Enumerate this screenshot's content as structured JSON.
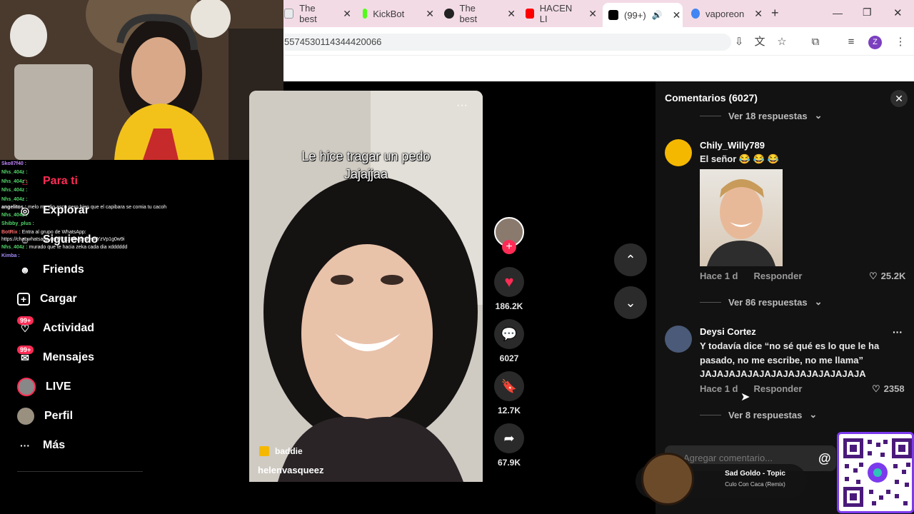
{
  "browser": {
    "tabs": [
      {
        "label": "The best",
        "color": "#e8eaed"
      },
      {
        "label": "KickBot",
        "color": "#53fc18"
      },
      {
        "label": "The best",
        "color": "#222222"
      },
      {
        "label": "HACEN LI",
        "color": "#ff0000"
      },
      {
        "label": "(99+)",
        "color": "#000000"
      },
      {
        "label": "vaporeon",
        "color": "#4285f4"
      }
    ],
    "url": "5574530114344420066",
    "profile_initial": "Z"
  },
  "nav": {
    "items": [
      {
        "label": "Para ti",
        "active": true
      },
      {
        "label": "Explorar"
      },
      {
        "label": "Siguiendo"
      },
      {
        "label": "Friends"
      },
      {
        "label": "Cargar"
      },
      {
        "label": "Actividad",
        "badge": "99+"
      },
      {
        "label": "Mensajes",
        "badge": "99+"
      },
      {
        "label": "LIVE"
      },
      {
        "label": "Perfil"
      },
      {
        "label": "Más"
      }
    ]
  },
  "chat": [
    {
      "user": "Sko87f40 :",
      "text": ""
    },
    {
      "user": "Nhs_404z :",
      "text": ""
    },
    {
      "user": "Nhs_404z :",
      "text": ""
    },
    {
      "user": "Nhs_404z :",
      "text": ""
    },
    {
      "user": "Nhs_404z :",
      "text": ""
    },
    {
      "user": "angelitos :",
      "text": "melo me dio asco pero bien que el capibara se comia tu cacoh"
    },
    {
      "user": "Nhs_404z :",
      "text": ""
    },
    {
      "user": "Shibby_plus :",
      "text": ""
    },
    {
      "user": "BotRix :",
      "text": "Entra al grupo de WhatsApp: https://chat.whatsapp.com/EE18KwpmrvsFYzVp1g0w9i"
    },
    {
      "user": "Nhs_404z :",
      "text": "murado que te hacia zeka cada dia xdddddd"
    },
    {
      "user": "Kimba :",
      "text": ""
    }
  ],
  "video": {
    "caption": [
      "Le hice tragar un pedo",
      "Jajajjaa"
    ],
    "tag": "baddie",
    "author": "helenvasqueez",
    "likes": "186.2K",
    "comments": "6027",
    "saves": "12.7K",
    "shares": "67.9K"
  },
  "comments": {
    "title": "Comentarios (6027)",
    "top_replies": "Ver 18 respuestas",
    "items": [
      {
        "user": "Chily_Willy789",
        "text": "El señor 😂 😂 😂",
        "time": "Hace 1 d",
        "reply": "Responder",
        "likes": "25.2K",
        "replies": "Ver 86 respuestas"
      },
      {
        "user": "Deysi Cortez",
        "text": "Y todavía dice “no sé qué es lo que le ha pasado, no me escribe, no me llama” JAJAJAJAJAJAJAJAJAJAJAJAJAJA",
        "time": "Hace 1 d",
        "reply": "Responder",
        "likes": "2358",
        "replies": "Ver 8 respuestas"
      }
    ],
    "input_placeholder": "Agregar comentario..."
  },
  "music": {
    "title": "Sad Goldo - Topic",
    "subtitle": "Culo Con Caca (Remix)"
  },
  "colors": {
    "accent": "#fe2c55",
    "panel": "#121212",
    "tabbar": "#f3dbe6"
  }
}
